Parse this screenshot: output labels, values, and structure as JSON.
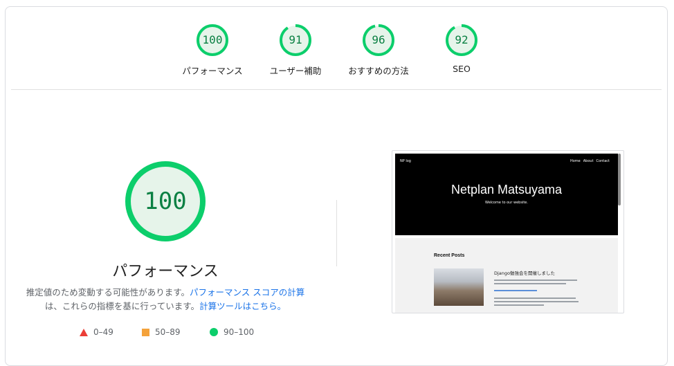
{
  "summary": {
    "gauges": [
      {
        "score": "100",
        "label": "パフォーマンス",
        "fraction": 1.0
      },
      {
        "score": "91",
        "label": "ユーザー補助",
        "fraction": 0.91
      },
      {
        "score": "96",
        "label": "おすすめの方法",
        "fraction": 0.96
      },
      {
        "score": "92",
        "label": "SEO",
        "fraction": 0.92
      }
    ]
  },
  "main": {
    "score": "100",
    "fraction": 1.0,
    "title": "パフォーマンス",
    "desc_prefix": "推定値のため変動する可能性があります。",
    "desc_link1": "パフォーマンス スコアの計算",
    "desc_middle": "は、これらの指標を基に行っています。",
    "desc_link2": "計算ツールはこちら。"
  },
  "legend": {
    "fail": "0–49",
    "average": "50–89",
    "pass": "90–100"
  },
  "colors": {
    "pass": "#0cce6b",
    "pass_text": "#0b8043",
    "pass_bg": "#e6f4ea",
    "average": "#f4a23b",
    "fail": "#eb3e37",
    "link": "#1a73e8"
  },
  "screenshot": {
    "brand": "NP log",
    "nav": [
      "Home",
      "About",
      "Contact"
    ],
    "hero_title": "Netplan Matsuyama",
    "hero_subtitle": "Welcome to our website.",
    "section_title": "Recent Posts",
    "post_title": "Django勉強会を開催しました"
  }
}
